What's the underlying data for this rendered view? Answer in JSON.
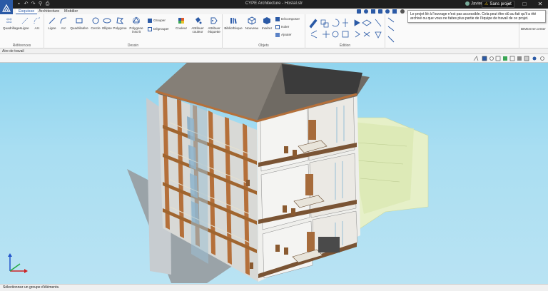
{
  "titlebar": {
    "title": "CYPE Architecture - Hostal.str",
    "user": "Javier",
    "project_badge": "Sans projet"
  },
  "tabs": [
    "Esquisse",
    "Architecture",
    "Mobilier"
  ],
  "ribbon": {
    "groups": {
      "references": "Références",
      "dessin": "Dessin",
      "objets": "Objets",
      "edition": "Édition"
    },
    "references": [
      "Quadrillages",
      "Ligne",
      "Arc"
    ],
    "dessin": [
      "Ligne",
      "Arc",
      "Quadrilatère",
      "Cercle",
      "Ellipse",
      "Polygone",
      "Polygone inscrit"
    ],
    "dessin_small": [
      "Grouper",
      "Dégrouper"
    ],
    "couleur": [
      "Couleur",
      "Attribuer couleur",
      "Attribuer étiquette"
    ],
    "objets": [
      "Bibliothèque",
      "Nouveau",
      "Insérer"
    ],
    "objets_small": [
      "Décomposer",
      "Isoler",
      "Ajouter"
    ],
    "bimserver": "BIMserver.center"
  },
  "tooltip": {
    "text": "Le projet lié à l'ouvrage n'est pas accessible. Cela peut être dû au fait qu'il a été archivé ou que vous ne faites plus partie de l'équipe de travail de ce projet."
  },
  "panel_tab": "Aire de travail",
  "status": "Sélectionnez un groupe d'éléments.",
  "colors": {
    "accent": "#2b5aa6",
    "sky": "#a9def2",
    "brick": "#b5703a",
    "wall": "#f0f0ee",
    "terrain": "#e4f0c6"
  }
}
